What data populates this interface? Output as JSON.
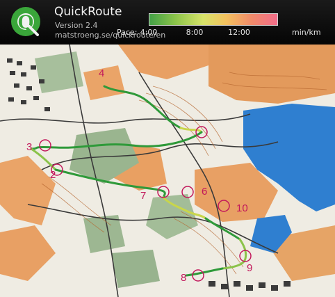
{
  "header": {
    "app_name": "QuickRoute",
    "version": "Version 2.4",
    "url": "matstroeng.se/quickroute/en",
    "logo_letter": "Q"
  },
  "pace_legend": {
    "label": "Pace:",
    "ticks": [
      "4:00",
      "8:00",
      "12:00"
    ],
    "unit": "min/km",
    "colors": [
      "#43a047",
      "#8bc34a",
      "#d7e36a",
      "#f3c15f",
      "#f08a6a",
      "#f26d8a"
    ]
  },
  "map": {
    "controls": [
      "2",
      "3",
      "4",
      "6",
      "7",
      "8",
      "9",
      "10"
    ],
    "colors": {
      "lake": "#2f7fd0",
      "open_land": "#e8a064",
      "forest": "#f4f1ea",
      "green": "#9ab58f",
      "route_green": "#2f9a3a",
      "route_yellow": "#c9d64a",
      "control_marker": "#c2185b"
    }
  }
}
